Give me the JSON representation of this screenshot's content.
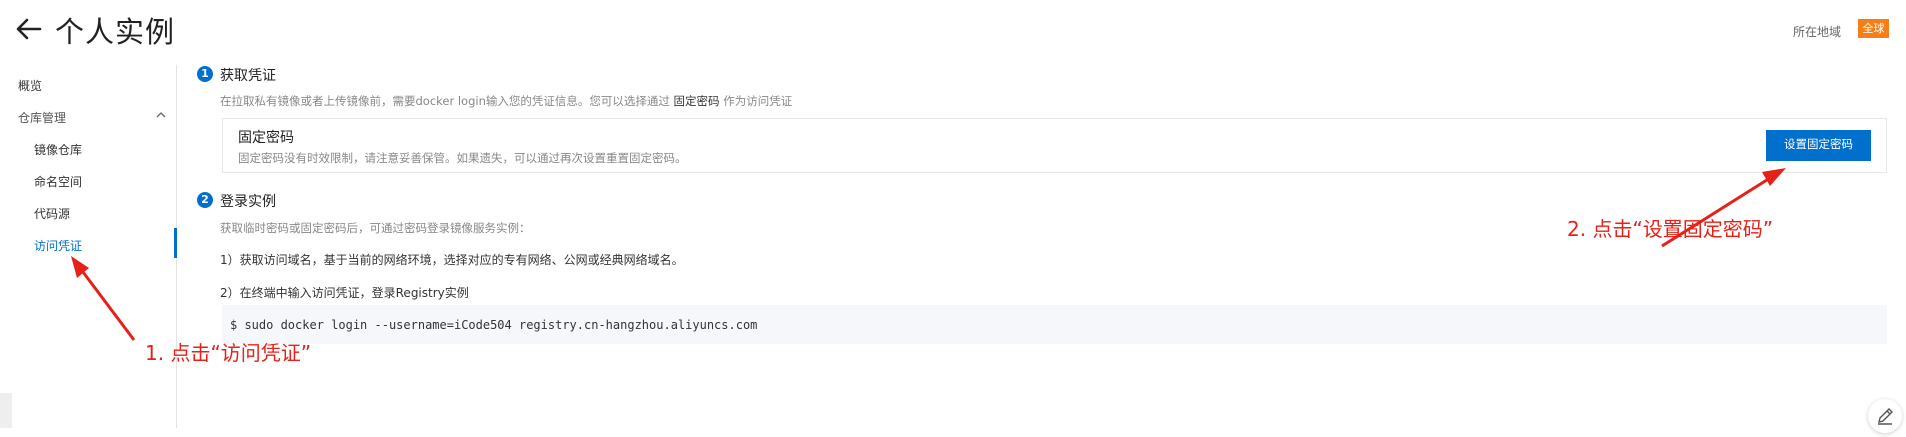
{
  "header": {
    "title": "个人实例",
    "region_label": "所在地域",
    "region_value": "全球"
  },
  "sidebar": {
    "overview": "概览",
    "repo_management": "仓库管理",
    "items": [
      {
        "label": "镜像仓库"
      },
      {
        "label": "命名空间"
      },
      {
        "label": "代码源"
      },
      {
        "label": "访问凭证"
      }
    ]
  },
  "step1": {
    "number": "1",
    "title": "获取凭证",
    "desc_prefix": "在拉取私有镜像或者上传镜像前，需要docker login输入您的凭证信息。您可以选择通过",
    "desc_highlight": "固定密码",
    "desc_suffix": "作为访问凭证",
    "card_title": "固定密码",
    "card_desc": "固定密码没有时效限制，请注意妥善保管。如果遗失，可以通过再次设置重置固定密码。",
    "button_label": "设置固定密码"
  },
  "step2": {
    "number": "2",
    "title": "登录实例",
    "desc": "获取临时密码或固定密码后，可通过密码登录镜像服务实例：",
    "line1": "1）获取访问域名，基于当前的网络环境，选择对应的专有网络、公网或经典网络域名。",
    "line2": "2）在终端中输入访问凭证，登录Registry实例",
    "code": "$ sudo docker login --username=iCode504 registry.cn-hangzhou.aliyuncs.com"
  },
  "annotations": {
    "note1": "1. 点击“访问凭证”",
    "note2": "2. 点击“设置固定密码”"
  },
  "colors": {
    "primary": "#0070cc",
    "badge": "#f57f17",
    "annotation": "#e5211a"
  }
}
